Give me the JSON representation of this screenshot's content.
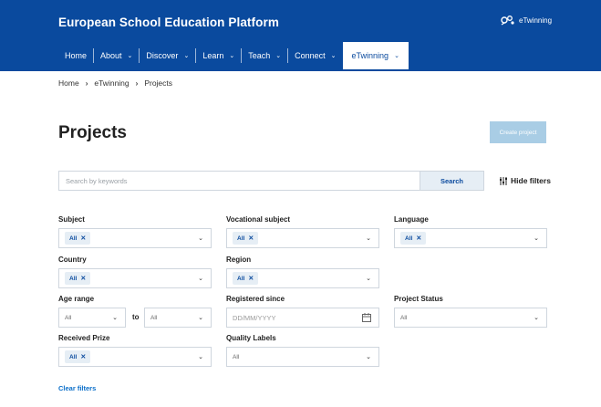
{
  "header": {
    "brand": "European School Education Platform",
    "logo_text": "eTwinning"
  },
  "nav": {
    "items": [
      {
        "label": "Home",
        "has_chevron": false
      },
      {
        "label": "About",
        "has_chevron": true
      },
      {
        "label": "Discover",
        "has_chevron": true
      },
      {
        "label": "Learn",
        "has_chevron": true
      },
      {
        "label": "Teach",
        "has_chevron": true
      },
      {
        "label": "Connect",
        "has_chevron": true
      },
      {
        "label": "eTwinning",
        "has_chevron": true,
        "active": true
      }
    ]
  },
  "breadcrumb": [
    "Home",
    "eTwinning",
    "Projects"
  ],
  "page": {
    "title": "Projects",
    "create_label": "Create project"
  },
  "search": {
    "placeholder": "Search by keywords",
    "button_label": "Search",
    "hide_filters_label": "Hide filters"
  },
  "filters": {
    "subject": {
      "label": "Subject",
      "chip": "All"
    },
    "vocational": {
      "label": "Vocational subject",
      "chip": "All"
    },
    "language": {
      "label": "Language",
      "chip": "All"
    },
    "country": {
      "label": "Country",
      "chip": "All"
    },
    "region": {
      "label": "Region",
      "chip": "All"
    },
    "age": {
      "label": "Age range",
      "from": "All",
      "to_label": "to",
      "to": "All"
    },
    "registered": {
      "label": "Registered since",
      "placeholder": "DD/MM/YYYY"
    },
    "status": {
      "label": "Project Status",
      "value": "All"
    },
    "prize": {
      "label": "Received Prize",
      "chip": "All"
    },
    "quality": {
      "label": "Quality Labels",
      "value": "All"
    }
  },
  "clear_filters_label": "Clear filters",
  "colors": {
    "header_bg": "#0a4a9e",
    "chip_bg": "#e6eef5",
    "create_btn": "#a9cde5",
    "link": "#0a6ec9"
  }
}
